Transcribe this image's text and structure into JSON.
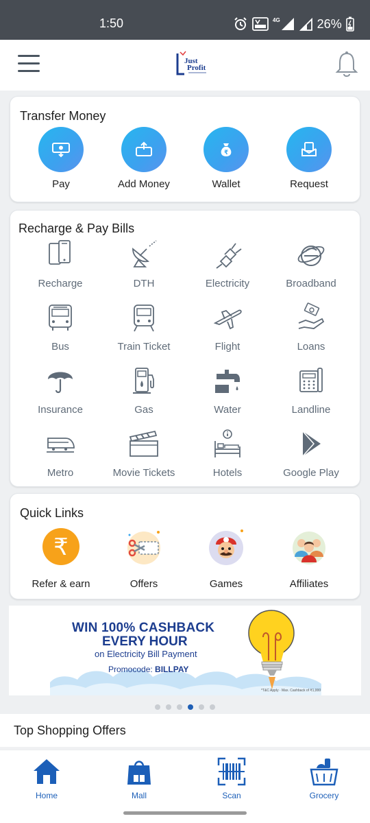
{
  "status_bar": {
    "time": "1:50",
    "network_label": "4G",
    "battery": "26%"
  },
  "header": {
    "logo_text_line1": "Just",
    "logo_text_line2": "Profit"
  },
  "transfer_money": {
    "title": "Transfer Money",
    "items": [
      {
        "label": "Pay",
        "icon": "cash-icon"
      },
      {
        "label": "Add Money",
        "icon": "add-money-icon"
      },
      {
        "label": "Wallet",
        "icon": "money-bag-icon"
      },
      {
        "label": "Request",
        "icon": "request-icon"
      }
    ]
  },
  "recharge": {
    "title": "Recharge & Pay Bills",
    "items": [
      {
        "label": "Recharge",
        "icon": "mobile-icon"
      },
      {
        "label": "DTH",
        "icon": "satellite-dish-icon"
      },
      {
        "label": "Electricity",
        "icon": "plug-icon"
      },
      {
        "label": "Broadband",
        "icon": "internet-icon"
      },
      {
        "label": "Bus",
        "icon": "bus-icon"
      },
      {
        "label": "Train Ticket",
        "icon": "train-icon"
      },
      {
        "label": "Flight",
        "icon": "airplane-icon"
      },
      {
        "label": "Loans",
        "icon": "loan-hand-icon"
      },
      {
        "label": "Insurance",
        "icon": "umbrella-icon"
      },
      {
        "label": "Gas",
        "icon": "gas-station-icon"
      },
      {
        "label": "Water",
        "icon": "water-tap-icon"
      },
      {
        "label": "Landline",
        "icon": "landline-icon"
      },
      {
        "label": "Metro",
        "icon": "metro-train-icon"
      },
      {
        "label": "Movie Tickets",
        "icon": "clapperboard-icon"
      },
      {
        "label": "Hotels",
        "icon": "hotel-bed-icon"
      },
      {
        "label": "Google Play",
        "icon": "google-play-icon"
      }
    ]
  },
  "quick_links": {
    "title": "Quick Links",
    "items": [
      {
        "label": "Refer & earn",
        "icon": "rupee-icon"
      },
      {
        "label": "Offers",
        "icon": "scissors-coupon-icon"
      },
      {
        "label": "Games",
        "icon": "game-character-icon"
      },
      {
        "label": "Affiliates",
        "icon": "people-group-icon"
      }
    ]
  },
  "banner": {
    "line1": "WIN 100% CASHBACK",
    "line2": "EVERY HOUR",
    "subtitle": "on Electricity Bill Payment",
    "promo_prefix": "Promocode: ",
    "promo_code": "BILLPAY",
    "terms": "*T&C Apply · Max. Cashback of ₹1,000"
  },
  "carousel": {
    "count": 6,
    "active_index": 4
  },
  "top_offers": {
    "title": "Top Shopping Offers"
  },
  "bottom_nav": [
    {
      "label": "Home",
      "icon": "home-icon"
    },
    {
      "label": "Mall",
      "icon": "shopping-bag-icon"
    },
    {
      "label": "Scan",
      "icon": "barcode-scan-icon"
    },
    {
      "label": "Grocery",
      "icon": "grocery-basket-icon"
    }
  ],
  "colors": {
    "accent_blue": "#1c5fb8",
    "icon_grey": "#5f6b78",
    "circle_blue": "#3aa7ef",
    "status_bar": "#474c53",
    "orange": "#f7a21a"
  }
}
